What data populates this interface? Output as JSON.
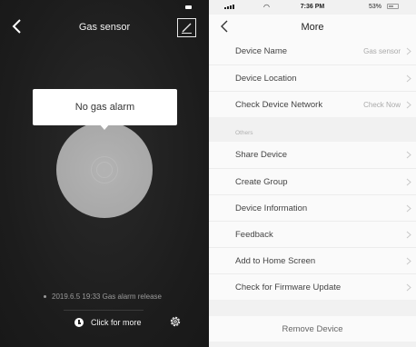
{
  "left_screen": {
    "title": "Gas sensor",
    "alarm_status": "No gas alarm",
    "last_event": "2019.6.5 19:33 Gas alarm release",
    "more_label": "Click for more",
    "icons": {
      "back": "chevron-left-icon",
      "edit": "edit-icon",
      "battery": "battery-icon",
      "history": "clock-icon",
      "settings": "gear-icon"
    }
  },
  "right_screen": {
    "status_bar": {
      "time": "7:36 PM",
      "battery": "53%"
    },
    "title": "More",
    "device_rows": [
      {
        "label": "Device Name",
        "value": "Gas sensor"
      },
      {
        "label": "Device Location",
        "value": ""
      },
      {
        "label": "Check Device Network",
        "value": "Check Now"
      }
    ],
    "section_label": "Others",
    "other_rows": [
      {
        "label": "Share Device"
      },
      {
        "label": "Create Group"
      },
      {
        "label": "Device Information"
      },
      {
        "label": "Feedback"
      },
      {
        "label": "Add to Home Screen"
      },
      {
        "label": "Check for Firmware Update"
      }
    ],
    "remove_label": "Remove Device"
  },
  "colors": {
    "dark_bg": "#1c1c1c",
    "disc": "#aaaaaa",
    "list_bg": "#fafafa",
    "page_bg": "#f1f1f1"
  }
}
